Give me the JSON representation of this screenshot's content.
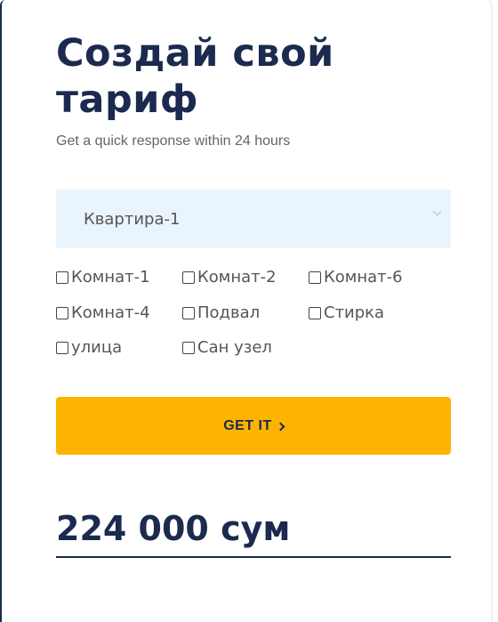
{
  "form": {
    "title": "Создай свой тариф",
    "subtitle": "Get a quick response within 24 hours",
    "select": {
      "selected": "Квартира-1",
      "icon": "chevron-down-icon"
    },
    "options": [
      {
        "label": "Комнат-1",
        "checked": false
      },
      {
        "label": "Комнат-2",
        "checked": false
      },
      {
        "label": "Комнат-6",
        "checked": false
      },
      {
        "label": "Комнат-4",
        "checked": false
      },
      {
        "label": "Подвал",
        "checked": false
      },
      {
        "label": "Стирка",
        "checked": false
      },
      {
        "label": "улица",
        "checked": false
      },
      {
        "label": "Сан узел",
        "checked": false
      }
    ],
    "button": {
      "label": "GET IT",
      "icon": "chevron-right-icon"
    },
    "price": "224 000 сум"
  },
  "colors": {
    "navy": "#1b2a4e",
    "accent_yellow": "#fdb400",
    "select_bg": "#eaf4fd"
  }
}
